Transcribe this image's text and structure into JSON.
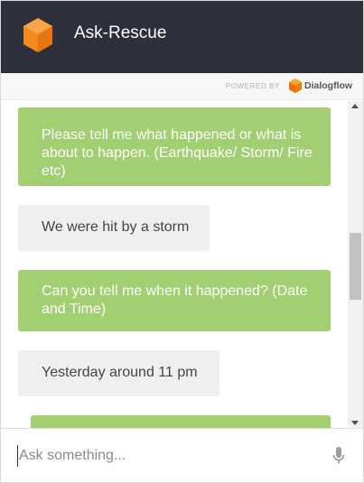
{
  "header": {
    "title": "Ask-Rescue",
    "logo_icon": "orange-cube-logo",
    "bg_color": "#2d2f3a"
  },
  "powered": {
    "label": "POWERED BY",
    "brand": "Dialogflow",
    "brand_icon": "dialogflow-logo"
  },
  "messages": [
    {
      "from": "bot",
      "text": "Please tell me what happened or what is about to happen. (Earthquake/ Storm/ Fire etc)"
    },
    {
      "from": "user",
      "text": "We were hit by a storm"
    },
    {
      "from": "bot",
      "text": "Can you tell me when it happened? (Date and Time)"
    },
    {
      "from": "user",
      "text": "Yesterday around 11 pm"
    },
    {
      "from": "bot",
      "text": ""
    }
  ],
  "colors": {
    "bot_bubble": "#a2cf72",
    "user_bubble": "#efefef"
  },
  "input": {
    "placeholder": "Ask something...",
    "value": "",
    "mic_icon": "microphone-icon"
  }
}
